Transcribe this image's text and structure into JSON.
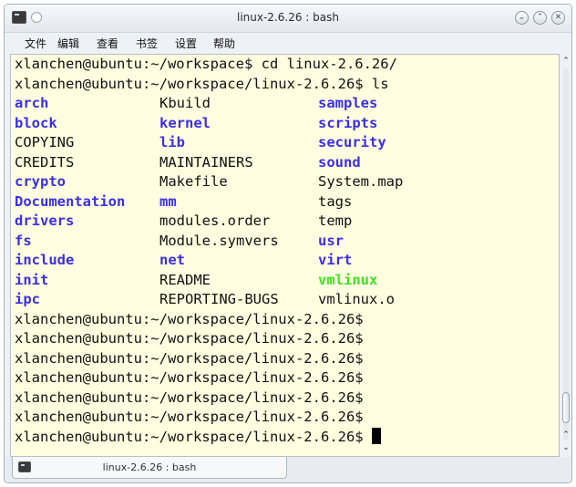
{
  "window": {
    "title": "linux-2.6.26 : bash"
  },
  "menu": {
    "items": [
      "文件",
      "编辑",
      "查看",
      "书签",
      "设置",
      "帮助"
    ]
  },
  "terminal": {
    "lines_before": [
      "xlanchen@ubuntu:~/workspace$ cd linux-2.6.26/",
      "xlanchen@ubuntu:~/workspace/linux-2.6.26$ ls"
    ],
    "ls_columns": [
      [
        {
          "name": "arch",
          "type": "dir"
        },
        {
          "name": "block",
          "type": "dir"
        },
        {
          "name": "COPYING",
          "type": "file"
        },
        {
          "name": "CREDITS",
          "type": "file"
        },
        {
          "name": "crypto",
          "type": "dir"
        },
        {
          "name": "Documentation",
          "type": "dir"
        },
        {
          "name": "drivers",
          "type": "dir"
        },
        {
          "name": "fs",
          "type": "dir"
        },
        {
          "name": "include",
          "type": "dir"
        },
        {
          "name": "init",
          "type": "dir"
        },
        {
          "name": "ipc",
          "type": "dir"
        }
      ],
      [
        {
          "name": "Kbuild",
          "type": "file"
        },
        {
          "name": "kernel",
          "type": "dir"
        },
        {
          "name": "lib",
          "type": "dir"
        },
        {
          "name": "MAINTAINERS",
          "type": "file"
        },
        {
          "name": "Makefile",
          "type": "file"
        },
        {
          "name": "mm",
          "type": "dir"
        },
        {
          "name": "modules.order",
          "type": "file"
        },
        {
          "name": "Module.symvers",
          "type": "file"
        },
        {
          "name": "net",
          "type": "dir"
        },
        {
          "name": "README",
          "type": "file"
        },
        {
          "name": "REPORTING-BUGS",
          "type": "file"
        }
      ],
      [
        {
          "name": "samples",
          "type": "dir"
        },
        {
          "name": "scripts",
          "type": "dir"
        },
        {
          "name": "security",
          "type": "dir"
        },
        {
          "name": "sound",
          "type": "dir"
        },
        {
          "name": "System.map",
          "type": "file"
        },
        {
          "name": "tags",
          "type": "file"
        },
        {
          "name": "temp",
          "type": "file"
        },
        {
          "name": "usr",
          "type": "dir"
        },
        {
          "name": "virt",
          "type": "dir"
        },
        {
          "name": "vmlinux",
          "type": "exec"
        },
        {
          "name": "vmlinux.o",
          "type": "file"
        }
      ]
    ],
    "lines_after": [
      "xlanchen@ubuntu:~/workspace/linux-2.6.26$",
      "xlanchen@ubuntu:~/workspace/linux-2.6.26$",
      "xlanchen@ubuntu:~/workspace/linux-2.6.26$",
      "xlanchen@ubuntu:~/workspace/linux-2.6.26$",
      "xlanchen@ubuntu:~/workspace/linux-2.6.26$",
      "xlanchen@ubuntu:~/workspace/linux-2.6.26$"
    ],
    "current_prompt": "xlanchen@ubuntu:~/workspace/linux-2.6.26$ "
  },
  "tab": {
    "label": "linux-2.6.26 : bash"
  },
  "colors": {
    "terminal_bg": "#fffee0",
    "dir": "#3a2ee8",
    "exec": "#3ee41d",
    "text": "#111111"
  },
  "icons": {
    "app": "terminal-icon",
    "pin": "pin-icon",
    "minimize": "minimize-icon",
    "maximize": "maximize-icon",
    "close": "close-icon"
  }
}
